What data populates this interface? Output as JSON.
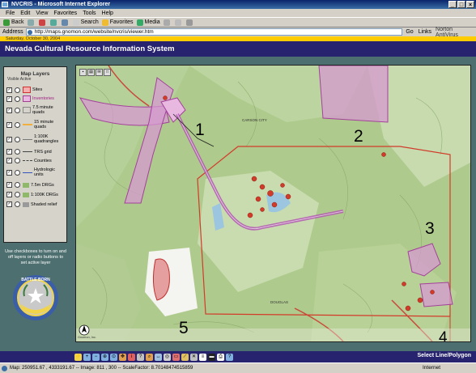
{
  "window": {
    "title": "NVCRIS - Microsoft Internet Explorer",
    "min": "_",
    "max": "□",
    "close": "×"
  },
  "menu": [
    "File",
    "Edit",
    "View",
    "Favorites",
    "Tools",
    "Help"
  ],
  "toolbar": {
    "back": "Back",
    "search": "Search",
    "favorites": "Favorites",
    "media": "Media"
  },
  "address": {
    "label": "Address",
    "url": "http://maps.gnomon.com/website/nvcris/viewer.htm",
    "go": "Go",
    "links": "Links",
    "norton": "Norton AntiVirus"
  },
  "date_line": "Saturday, October 30, 2004",
  "app_title": "Nevada Cultural Resource Information System",
  "layers_panel": {
    "title": "Map Layers",
    "col_headers": "Visible Active",
    "items": [
      {
        "label": "Sites",
        "visible": true,
        "swatch": "#e05a5a"
      },
      {
        "label": "Inventories",
        "visible": true,
        "swatch": "#c968b0"
      },
      {
        "label": "7.5 minute quads",
        "visible": true,
        "swatch": "#ffffff"
      },
      {
        "label": "15 minute quads",
        "visible": true,
        "swatch": "#f0b040"
      },
      {
        "label": "1:100K quadrangles",
        "visible": true,
        "swatch": "#ffffff"
      },
      {
        "label": "TRS grid",
        "visible": true,
        "swatch": "#444444"
      },
      {
        "label": "Counties",
        "visible": true,
        "swatch": "#444444"
      },
      {
        "label": "Hydrologic units",
        "visible": true,
        "swatch": "#3355bb"
      },
      {
        "label": "7.5m DRGs",
        "visible": true,
        "swatch": "#6a9a4a"
      },
      {
        "label": "1:100K DRGs",
        "visible": true,
        "swatch": "#6a9a4a"
      },
      {
        "label": "Shaded relief",
        "visible": true,
        "swatch": "#8a8a8a"
      }
    ],
    "instructions": "Use checkboxes to turn on and off layers or radio buttons to set active layer",
    "seal_text": "BATTLE BORN"
  },
  "map": {
    "callouts": [
      "1",
      "2",
      "3",
      "4",
      "5"
    ],
    "places": [
      "CARSON CITY",
      "DOUGLAS",
      "Gnomon, Inc."
    ],
    "tool_icons": [
      "save-icon",
      "print-icon",
      "envelope-icon",
      "window-icon"
    ]
  },
  "bottom_toolbar": {
    "selection_mode": "Select Line/Polygon"
  },
  "status": {
    "text": "Map: 250951.67 , 4333191.67 -- Image: 811 , 300 -- ScaleFactor: 8.70148474515859",
    "zone": "Internet"
  },
  "colors": {
    "header_bg": "#27236e",
    "sidebar_bg": "#4d6f6f",
    "inventory": "#c968b0",
    "sites": "#e05a5a",
    "date_bar": "#ffcc00"
  }
}
